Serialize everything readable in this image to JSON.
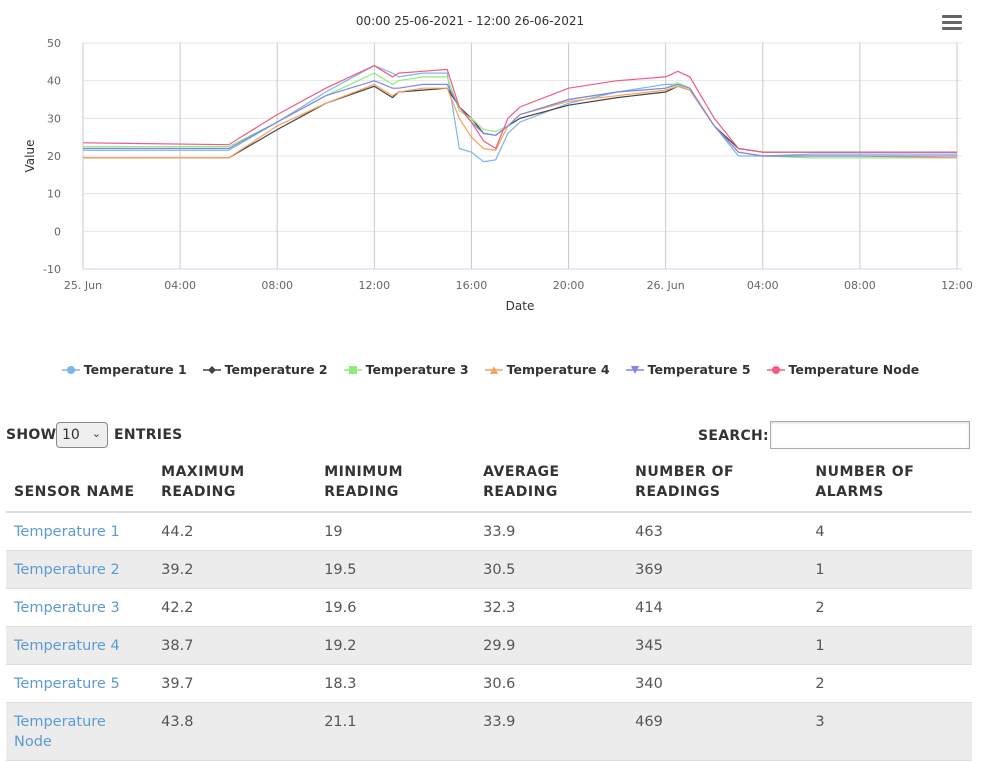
{
  "chart_data": {
    "type": "line",
    "title": "00:00 25-06-2021 - 12:00 26-06-2021",
    "xlabel": "Date",
    "ylabel": "Value",
    "ylim": [
      -10,
      50
    ],
    "yticks": [
      -10,
      0,
      10,
      20,
      30,
      40,
      50
    ],
    "xlim_hours": [
      0,
      36
    ],
    "xticks": [
      {
        "hour": 0,
        "label": "25. Jun"
      },
      {
        "hour": 4,
        "label": "04:00"
      },
      {
        "hour": 8,
        "label": "08:00"
      },
      {
        "hour": 12,
        "label": "12:00"
      },
      {
        "hour": 16,
        "label": "16:00"
      },
      {
        "hour": 20,
        "label": "20:00"
      },
      {
        "hour": 24,
        "label": "26. Jun"
      },
      {
        "hour": 28,
        "label": "04:00"
      },
      {
        "hour": 32,
        "label": "08:00"
      },
      {
        "hour": 36,
        "label": "12:00"
      }
    ],
    "grid": true,
    "legend_position": "bottom",
    "x": [
      "00:00",
      "06:00",
      "08:00",
      "10:00",
      "12:00",
      "12:45",
      "13:00",
      "14:00",
      "15:00",
      "15:30",
      "16:00",
      "16:30",
      "17:00",
      "17:30",
      "18:00",
      "20:00",
      "22:00",
      "24:00",
      "24:30",
      "25:00",
      "26:00",
      "27:00",
      "28:00",
      "30:00",
      "32:00",
      "36:00"
    ],
    "series": [
      {
        "name": "Temperature 1",
        "color": "#7cb5ec",
        "symbol": "circle",
        "values": [
          21.5,
          21.5,
          29,
          37,
          44,
          42,
          41,
          42,
          42,
          22,
          21,
          18.5,
          19,
          26,
          29,
          34,
          37,
          39,
          39,
          38,
          28,
          20,
          20,
          20.5,
          20.5,
          20.5
        ]
      },
      {
        "name": "Temperature 2",
        "color": "#434348",
        "symbol": "diamond",
        "values": [
          19.5,
          19.5,
          27,
          34,
          38.5,
          35.5,
          37,
          37.5,
          38,
          33,
          30,
          26,
          25.5,
          28,
          30,
          33.5,
          35.5,
          37,
          38.5,
          37.5,
          28,
          22,
          21,
          21,
          21,
          21
        ]
      },
      {
        "name": "Temperature 3",
        "color": "#90ed7d",
        "symbol": "square",
        "values": [
          22.5,
          22.5,
          29,
          36,
          42,
          39,
          40,
          41,
          41,
          32,
          30,
          27,
          26.5,
          28,
          31,
          35,
          37,
          38,
          39.5,
          38,
          28,
          21,
          20,
          19.5,
          19.5,
          19.5
        ]
      },
      {
        "name": "Temperature 4",
        "color": "#f7a35c",
        "symbol": "triangle",
        "values": [
          19.5,
          19.5,
          28,
          34,
          39,
          36,
          37,
          38,
          38,
          30,
          25,
          22,
          21.5,
          28,
          31,
          34.5,
          36,
          37.5,
          38.5,
          37.5,
          28,
          21,
          20,
          20,
          20,
          19.5
        ]
      },
      {
        "name": "Temperature 5",
        "color": "#8085e9",
        "symbol": "triangle-down",
        "values": [
          22,
          22,
          29,
          36,
          40,
          38,
          38,
          39,
          39,
          33,
          29,
          26,
          25.5,
          28,
          31,
          35,
          37,
          38,
          39,
          38,
          28,
          21,
          20,
          20,
          20,
          20
        ]
      },
      {
        "name": "Temperature Node",
        "color": "#f15c80",
        "symbol": "circle",
        "values": [
          23.5,
          23,
          31,
          38,
          44,
          41,
          42,
          42.5,
          43,
          33,
          29,
          24,
          22,
          30,
          33,
          38,
          40,
          41,
          42.5,
          41,
          30,
          22,
          21,
          21,
          21,
          21
        ]
      }
    ]
  },
  "menu_icon": "hamburger-menu-icon",
  "controls": {
    "show_label": "SHOW",
    "page_size": "10",
    "entries_label": "ENTRIES",
    "search_label": "SEARCH:",
    "search_value": ""
  },
  "table": {
    "headers": [
      "SENSOR NAME",
      "MAXIMUM READING",
      "MINIMUM READING",
      "AVERAGE READING",
      "NUMBER OF READINGS",
      "NUMBER OF ALARMS"
    ],
    "header_lines": [
      [
        "SENSOR NAME"
      ],
      [
        "MAXIMUM",
        "READING"
      ],
      [
        "MINIMUM",
        "READING"
      ],
      [
        "AVERAGE",
        "READING"
      ],
      [
        "NUMBER OF",
        "READINGS"
      ],
      [
        "NUMBER OF",
        "ALARMS"
      ]
    ],
    "rows": [
      {
        "sensor": "Temperature 1",
        "max": "44.2",
        "min": "19",
        "avg": "33.9",
        "readings": "463",
        "alarms": "4"
      },
      {
        "sensor": "Temperature 2",
        "max": "39.2",
        "min": "19.5",
        "avg": "30.5",
        "readings": "369",
        "alarms": "1"
      },
      {
        "sensor": "Temperature 3",
        "max": "42.2",
        "min": "19.6",
        "avg": "32.3",
        "readings": "414",
        "alarms": "2"
      },
      {
        "sensor": "Temperature 4",
        "max": "38.7",
        "min": "19.2",
        "avg": "29.9",
        "readings": "345",
        "alarms": "1"
      },
      {
        "sensor": "Temperature 5",
        "max": "39.7",
        "min": "18.3",
        "avg": "30.6",
        "readings": "340",
        "alarms": "2"
      },
      {
        "sensor": "Temperature Node",
        "max": "43.8",
        "min": "21.1",
        "avg": "33.9",
        "readings": "469",
        "alarms": "3"
      }
    ]
  }
}
